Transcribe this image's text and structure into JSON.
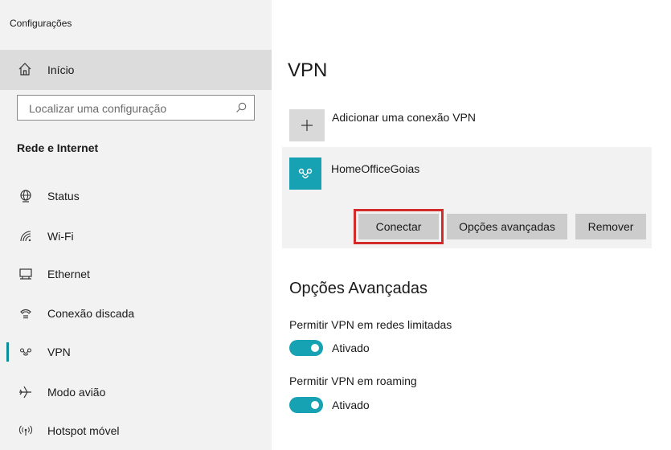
{
  "window": {
    "title": "Configurações"
  },
  "sidebar": {
    "home_label": "Início",
    "search_placeholder": "Localizar uma configuração",
    "section_title": "Rede e Internet",
    "items": [
      {
        "label": "Status",
        "icon": "status-globe-icon",
        "selected": false
      },
      {
        "label": "Wi-Fi",
        "icon": "wifi-icon",
        "selected": false
      },
      {
        "label": "Ethernet",
        "icon": "ethernet-icon",
        "selected": false
      },
      {
        "label": "Conexão discada",
        "icon": "dialup-icon",
        "selected": false
      },
      {
        "label": "VPN",
        "icon": "vpn-icon",
        "selected": true
      },
      {
        "label": "Modo avião",
        "icon": "airplane-icon",
        "selected": false
      },
      {
        "label": "Hotspot móvel",
        "icon": "hotspot-icon",
        "selected": false
      }
    ]
  },
  "main": {
    "title": "VPN",
    "add_vpn_label": "Adicionar uma conexão VPN",
    "vpn_connection": {
      "name": "HomeOfficeGoias",
      "buttons": {
        "connect": "Conectar",
        "advanced": "Opções avançadas",
        "remove": "Remover"
      }
    },
    "advanced_section": {
      "title": "Opções Avançadas",
      "options": [
        {
          "label": "Permitir VPN em redes limitadas",
          "state_text": "Ativado",
          "on": true
        },
        {
          "label": "Permitir VPN em roaming",
          "state_text": "Ativado",
          "on": true
        }
      ]
    }
  },
  "colors": {
    "accent": "#17a2b4",
    "selection_bar": "#0a8f9a",
    "highlight_frame": "#d32a2a",
    "sidebar_bg": "#f2f2f2"
  }
}
